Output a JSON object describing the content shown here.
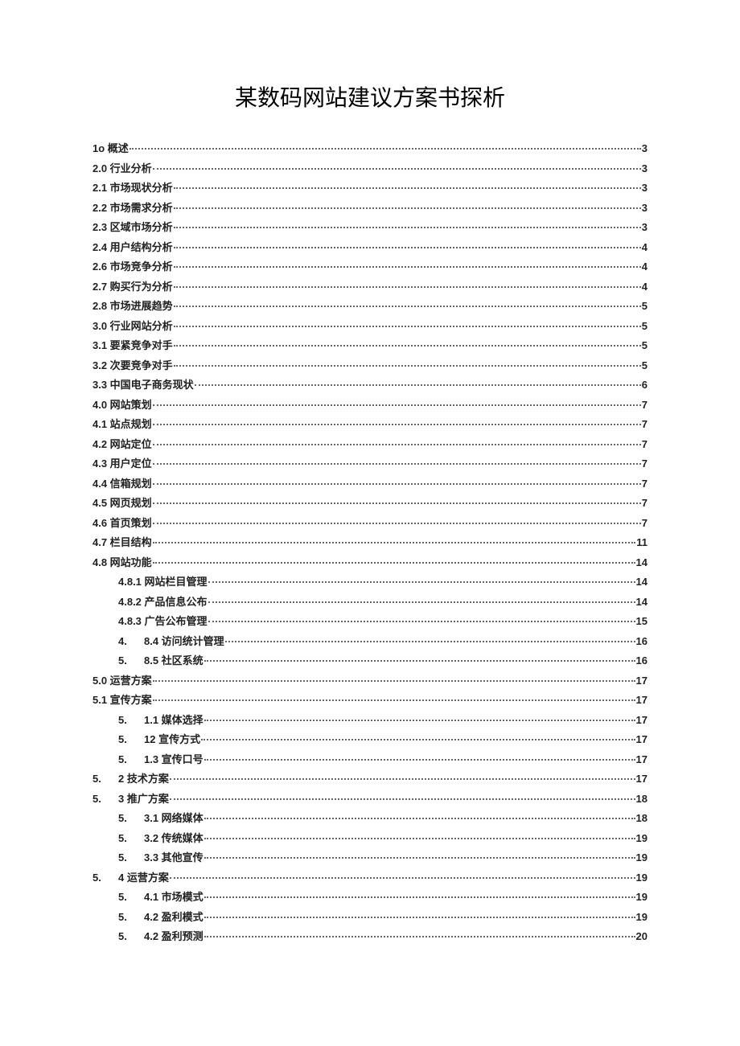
{
  "title": "某数码网站建议方案书探析",
  "toc": [
    {
      "label": "1o 概述",
      "page": "3",
      "indent": 0
    },
    {
      "label": "2.0 行业分析",
      "page": "3",
      "indent": 0
    },
    {
      "label": "2.1 市场现状分析",
      "page": "3",
      "indent": 0
    },
    {
      "label": "2.2 市场需求分析",
      "page": "3",
      "indent": 0
    },
    {
      "label": "2.3 区域市场分析",
      "page": "3",
      "indent": 0
    },
    {
      "label": "2.4 用户结构分析",
      "page": "4",
      "indent": 0
    },
    {
      "label": "2.6 市场竞争分析",
      "page": "4",
      "indent": 0
    },
    {
      "label": "2.7 购买行为分析",
      "page": "4",
      "indent": 0
    },
    {
      "label": "2.8 市场进展趋势",
      "page": "5",
      "indent": 0
    },
    {
      "label": "3.0 行业网站分析",
      "page": "5",
      "indent": 0
    },
    {
      "label": "3.1 要紧竞争对手",
      "page": "5",
      "indent": 0
    },
    {
      "label": "3.2 次要竞争对手",
      "page": "5",
      "indent": 0
    },
    {
      "label": "3.3 中国电子商务现状",
      "page": "6",
      "indent": 0
    },
    {
      "label": "4.0 网站策划",
      "page": "7",
      "indent": 0
    },
    {
      "label": "4.1 站点规划",
      "page": "7",
      "indent": 0
    },
    {
      "label": "4.2 网站定位",
      "page": "7",
      "indent": 0
    },
    {
      "label": "4.3 用户定位",
      "page": "7",
      "indent": 0
    },
    {
      "label": "4.4 信箱规划",
      "page": "7",
      "indent": 0
    },
    {
      "label": "4.5 网页规划",
      "page": "7",
      "indent": 0
    },
    {
      "label": "4.6 首页策划",
      "page": "7",
      "indent": 0
    },
    {
      "label": "4.7 栏目结构",
      "page": "11",
      "indent": 0
    },
    {
      "label": "4.8 网站功能",
      "page": "14",
      "indent": 0
    },
    {
      "label": "4.8.1 网站栏目管理",
      "page": "14",
      "indent": 1
    },
    {
      "label": "4.8.2 产品信息公布",
      "page": "14",
      "indent": 1
    },
    {
      "label": "4.8.3 广告公布管理",
      "page": "15",
      "indent": 1
    },
    {
      "prefix": "4.",
      "label": "8.4 访问统计管理",
      "page": "16",
      "indent": 1
    },
    {
      "prefix": "5.",
      "label": "8.5 社区系统",
      "page": "16",
      "indent": 1
    },
    {
      "label": "5.0 运营方案",
      "page": "17",
      "indent": 0
    },
    {
      "label": "5.1 宣传方案",
      "page": "17",
      "indent": 0
    },
    {
      "prefix": "5.",
      "label": "1.1 媒体选择",
      "page": "17",
      "indent": 1
    },
    {
      "prefix": "5.",
      "label": "12 宣传方式",
      "page": "17",
      "indent": 1
    },
    {
      "prefix": "5.",
      "label": "1.3 宣传口号",
      "page": "17",
      "indent": 1
    },
    {
      "prefix": "5.",
      "label": "2 技术方案",
      "page": "17",
      "indent": 0
    },
    {
      "prefix": "5.",
      "label": "3 推广方案",
      "page": "18",
      "indent": 0
    },
    {
      "prefix": "5.",
      "label": "3.1 网络媒体",
      "page": "18",
      "indent": 1
    },
    {
      "prefix": "5.",
      "label": "3.2 传统媒体",
      "page": "19",
      "indent": 1
    },
    {
      "prefix": "5.",
      "label": "3.3 其他宣传",
      "page": "19",
      "indent": 1
    },
    {
      "prefix": "5.",
      "label": "4 运营方案",
      "page": "19",
      "indent": 0
    },
    {
      "prefix": "5.",
      "label": "4.1 市场模式",
      "page": "19",
      "indent": 1
    },
    {
      "prefix": "5.",
      "label": "4.2 盈利模式",
      "page": "19",
      "indent": 1
    },
    {
      "prefix": "5.",
      "label": "4.2 盈利预测",
      "page": "20",
      "indent": 1
    }
  ]
}
